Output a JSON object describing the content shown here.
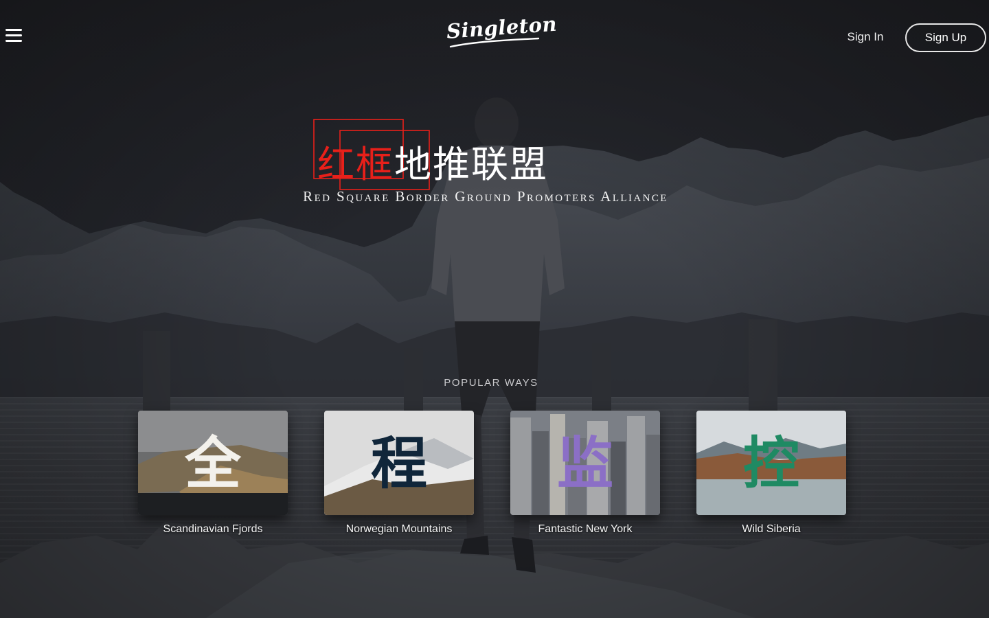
{
  "header": {
    "menu_icon": "hamburger-menu-icon",
    "logo_text": "Singleton",
    "sign_in_label": "Sign In",
    "sign_up_label": "Sign Up"
  },
  "hero": {
    "title_red": "红框",
    "title_white": "地推联盟",
    "subtitle": "Red Square Border Ground Promoters Alliance",
    "accent_color": "#e8201a"
  },
  "popular": {
    "heading": "POPULAR WAYS",
    "cards": [
      {
        "label": "Scandinavian Fjords",
        "glyph": "全",
        "glyph_color": "#f3f1ec"
      },
      {
        "label": "Norwegian Mountains",
        "glyph": "程",
        "glyph_color": "#10263a"
      },
      {
        "label": "Fantastic New York",
        "glyph": "监",
        "glyph_color": "#8b6fc6"
      },
      {
        "label": "Wild Siberia",
        "glyph": "控",
        "glyph_color": "#1f8a63"
      }
    ]
  }
}
